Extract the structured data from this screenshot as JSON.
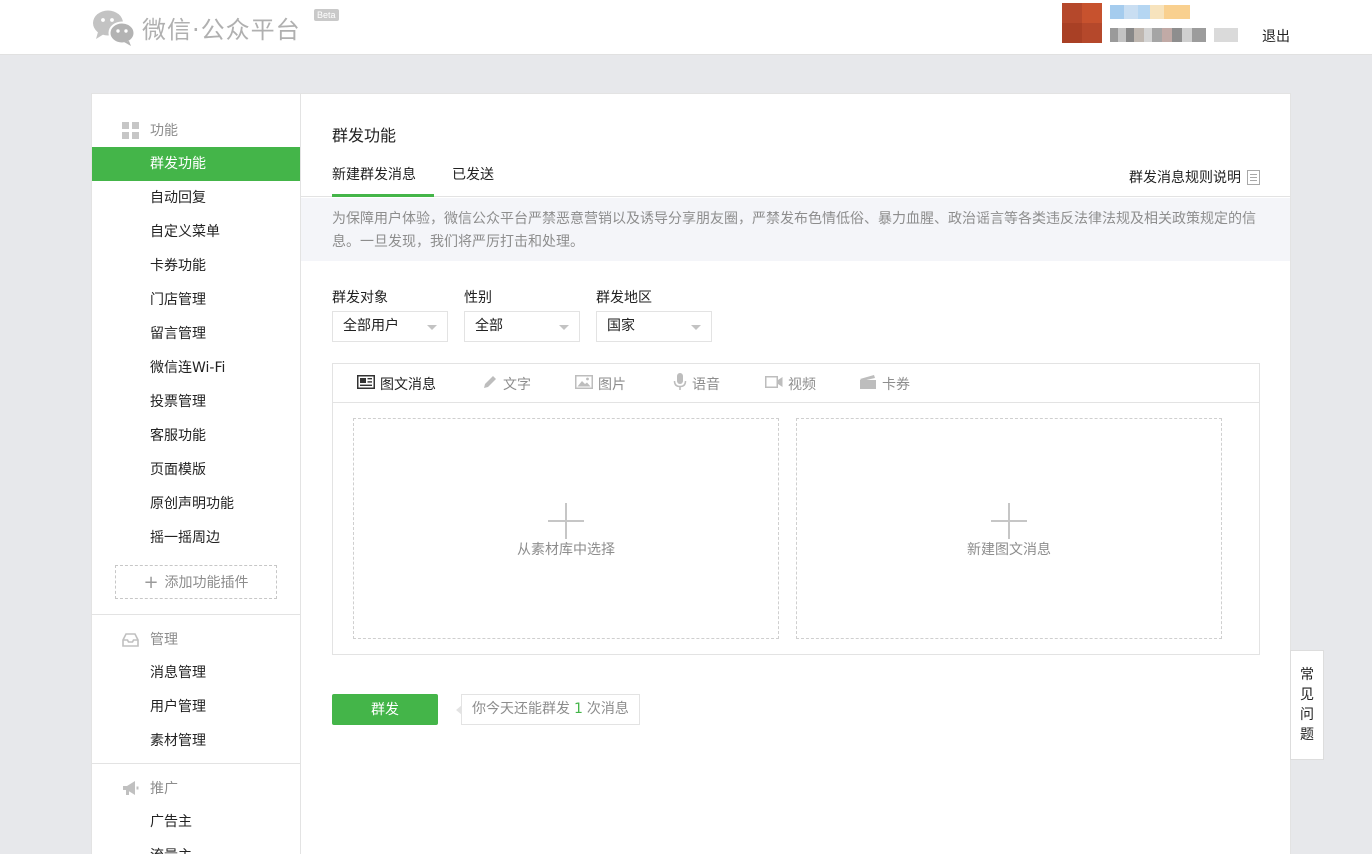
{
  "header": {
    "brand": "微信·公众平台",
    "beta": "Beta",
    "logout": "退出"
  },
  "sidebar": {
    "sections": [
      {
        "title": "功能",
        "icon": "grid-icon"
      },
      {
        "title": "管理",
        "icon": "inbox-icon"
      },
      {
        "title": "推广",
        "icon": "megaphone-icon"
      }
    ],
    "function_items": [
      "群发功能",
      "自动回复",
      "自定义菜单",
      "卡券功能",
      "门店管理",
      "留言管理",
      "微信连Wi-Fi",
      "投票管理",
      "客服功能",
      "页面模版",
      "原创声明功能",
      "摇一摇周边"
    ],
    "add_plugin": "添加功能插件",
    "manage_items": [
      "消息管理",
      "用户管理",
      "素材管理"
    ],
    "promo_items": [
      "广告主",
      "流量主"
    ]
  },
  "content": {
    "title": "群发功能",
    "tabs": [
      "新建群发消息",
      "已发送"
    ],
    "rule_link": "群发消息规则说明",
    "notice_line1": "为保障用户体验，微信公众平台严禁恶意营销以及诱导分享朋友圈，严禁发布色情低俗、暴力血腥、政治谣言等各类违反法律法规及相关政策规定的信",
    "notice_line2": "息。一旦发现，我们将严厉打击和处理。",
    "filters": {
      "target_label": "群发对象",
      "target_value": "全部用户",
      "gender_label": "性别",
      "gender_value": "全部",
      "region_label": "群发地区",
      "region_value": "国家"
    },
    "editor_tabs": [
      "图文消息",
      "文字",
      "图片",
      "语音",
      "视频",
      "卡券"
    ],
    "drop_library": "从素材库中选择",
    "drop_new": "新建图文消息",
    "send_button": "群发",
    "quota_prefix": "你今天还能群发",
    "quota_count": "1",
    "quota_suffix": "次消息"
  },
  "faq": [
    "常",
    "见",
    "问",
    "题"
  ],
  "colors": {
    "accent": "#44b549",
    "muted": "#8d8d8d"
  }
}
